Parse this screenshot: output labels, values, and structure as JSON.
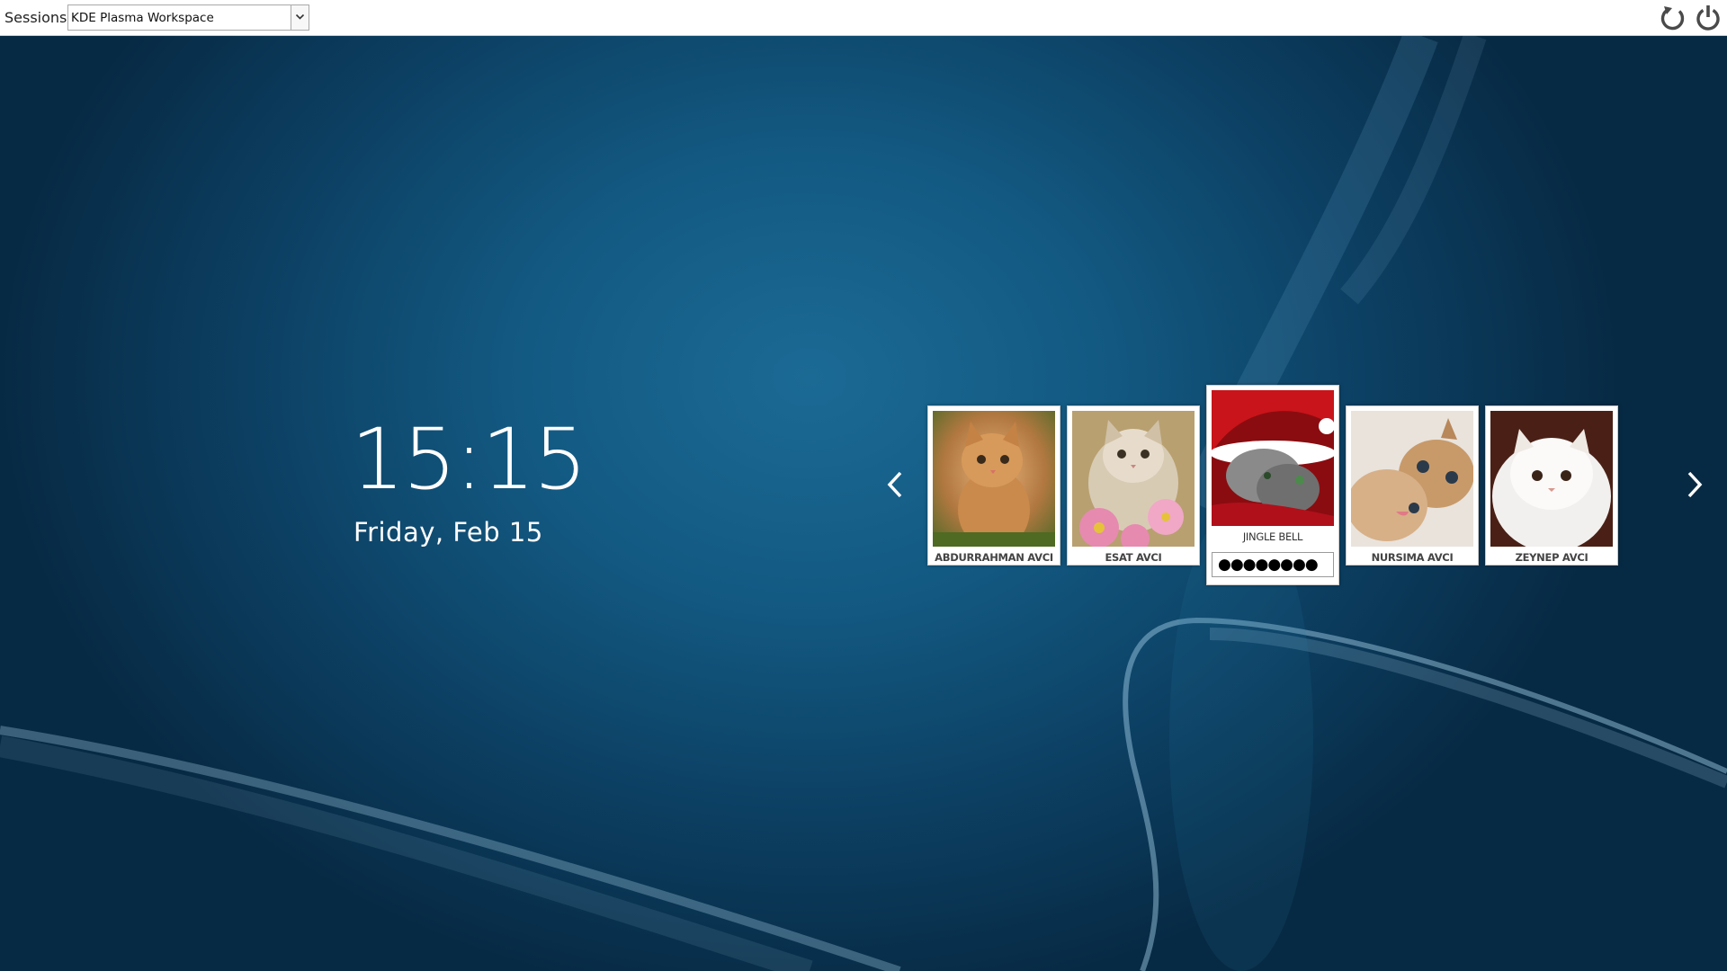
{
  "topbar": {
    "sessions_label": "Sessions:",
    "session_value": "KDE Plasma Workspace",
    "reboot_icon": "reboot-icon",
    "power_icon": "power-icon"
  },
  "clock": {
    "time": "15:15",
    "date": "Friday, Feb 15"
  },
  "navigation": {
    "prev_icon": "chevron-left-icon",
    "next_icon": "chevron-right-icon"
  },
  "users": [
    {
      "name": "ABDURRAHMAN AVCI",
      "photo": "orange-tabby-kitten",
      "selected": false
    },
    {
      "name": "ESAT AVCI",
      "photo": "fluffy-cream-kitten-flowers",
      "selected": false
    },
    {
      "name": "JINGLE BELL",
      "photo": "gray-cat-santa-hat",
      "selected": true
    },
    {
      "name": "NURSIMA AVCI",
      "photo": "tabby-kittens-cuddling",
      "selected": false
    },
    {
      "name": "ZEYNEP AVCI",
      "photo": "white-persian-cat",
      "selected": false
    }
  ],
  "password": {
    "masked_value": "●●●●●●●●"
  },
  "colors": {
    "background_center": "#1b6a95",
    "background_edge": "#072a44",
    "topbar": "#ffffff"
  }
}
